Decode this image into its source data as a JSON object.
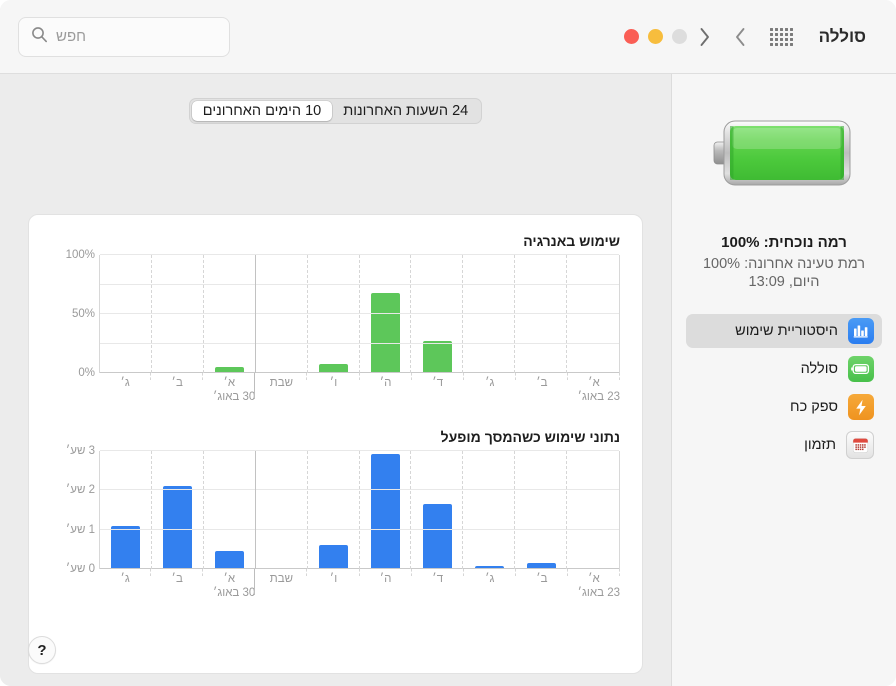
{
  "window": {
    "title": "סוללה"
  },
  "toolbar": {
    "search_placeholder": "חפש",
    "search_value": "",
    "search_icon": "search-icon",
    "grid_icon": "grid-view-icon",
    "back_icon": "chevron-back-icon",
    "forward_icon": "chevron-forward-icon",
    "traffic_lights": [
      {
        "name": "close-button",
        "color": "#fa5e55"
      },
      {
        "name": "minimize-button",
        "color": "#f7bd3d"
      },
      {
        "name": "zoom-button",
        "color": "#dddddd"
      }
    ]
  },
  "segmented": {
    "options": [
      {
        "label": "24 השעות האחרונות",
        "selected": false
      },
      {
        "label": "10 הימים האחרונים",
        "selected": true
      }
    ]
  },
  "chart_data": [
    {
      "type": "bar",
      "title": "שימוש באנרגיה",
      "categories": [
        "א׳",
        "ב׳",
        "ג׳",
        "ד׳",
        "ה׳",
        "ו׳",
        "שבת",
        "א׳",
        "ב׳",
        "ג׳"
      ],
      "values": [
        0,
        0,
        0,
        27,
        68,
        8,
        0,
        5,
        0,
        0
      ],
      "ytick_labels": [
        "100%",
        "50%",
        "0%"
      ],
      "ytick_values": [
        100,
        50,
        0
      ],
      "ylim": [
        0,
        100
      ],
      "gridlines": [
        0,
        25,
        50,
        75,
        100
      ],
      "xlabel": "",
      "ylabel": "",
      "week_labels": [
        "23 באוג׳",
        "30 באוג׳"
      ],
      "week_label_start_index": [
        0,
        7
      ],
      "bar_color": "#5dc75a",
      "direction": "rtl",
      "grid": true,
      "legend": "none"
    },
    {
      "type": "bar",
      "title": "נתוני שימוש כשהמסך מופעל",
      "categories": [
        "א׳",
        "ב׳",
        "ג׳",
        "ד׳",
        "ה׳",
        "ו׳",
        "שבת",
        "א׳",
        "ב׳",
        "ג׳"
      ],
      "values": [
        0,
        0.15,
        0.08,
        1.65,
        2.93,
        0.6,
        0.02,
        0.45,
        2.1,
        1.1
      ],
      "ytick_labels": [
        "3 שע׳",
        "2 שע׳",
        "1 שע׳",
        "0 שע׳"
      ],
      "ytick_values": [
        3,
        2,
        1,
        0
      ],
      "ylim": [
        0,
        3
      ],
      "gridlines": [
        0,
        1,
        2,
        3
      ],
      "xlabel": "",
      "ylabel": "שעות",
      "week_labels": [
        "23 באוג׳",
        "30 באוג׳"
      ],
      "week_label_start_index": [
        0,
        7
      ],
      "bar_color": "#3380ef",
      "direction": "rtl",
      "grid": true,
      "legend": "none"
    }
  ],
  "sidebar": {
    "battery_icon": "battery-full-icon",
    "battery_level_percent": 100,
    "status": {
      "current_level": "רמה נוכחית: 100%",
      "last_charge_level": "רמת טעינה אחרונה: 100%",
      "last_charge_time": "היום, 13:09"
    },
    "items": [
      {
        "label": "היסטוריית שימוש",
        "icon": "usage-history-icon",
        "selected": true
      },
      {
        "label": "סוללה",
        "icon": "battery-icon",
        "selected": false
      },
      {
        "label": "ספק כח",
        "icon": "power-adapter-icon",
        "selected": false
      },
      {
        "label": "תזמון",
        "icon": "schedule-icon",
        "selected": false
      }
    ]
  },
  "footer": {
    "help_label": "?"
  }
}
